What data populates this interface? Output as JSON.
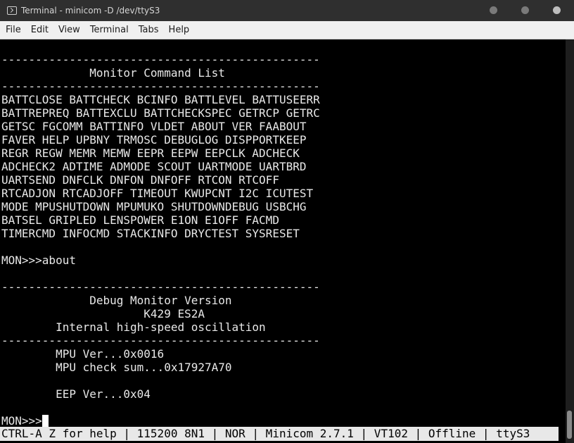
{
  "window": {
    "title": "Terminal - minicom -D /dev/ttyS3"
  },
  "menu": [
    "File",
    "Edit",
    "View",
    "Terminal",
    "Tabs",
    "Help"
  ],
  "terminal_lines": [
    "-----------------------------------------------",
    "             Monitor Command List",
    "-----------------------------------------------",
    "BATTCLOSE BATTCHECK BCINFO BATTLEVEL BATTUSEERR",
    "BATTREPREQ BATTEXCLU BATTCHECKSPEC GETRCP GETRC",
    "GETSC FGCOMM BATTINFO VLDET ABOUT VER FAABOUT",
    "FAVER HELP UPBNY TRMOSC DEBUGLOG DISPPORTKEEP",
    "REGR REGW MEMR MEMW EEPR EEPW EEPCLK ADCHECK",
    "ADCHECK2 ADTIME ADMODE SCOUT UARTMODE UARTBRD",
    "UARTSEND DNFCLK DNFON DNFOFF RTCON RTCOFF",
    "RTCADJON RTCADJOFF TIMEOUT KWUPCNT I2C ICUTEST",
    "MODE MPUSHUTDOWN MPUMUKO SHUTDOWNDEBUG USBCHG",
    "BATSEL GRIPLED LENSPOWER E1ON E1OFF FACMD",
    "TIMERCMD INFOCMD STACKINFO DRYCTEST SYSRESET",
    "",
    "MON>>>about",
    "",
    "-----------------------------------------------",
    "             Debug Monitor Version",
    "                     K429 ES2A",
    "        Internal high-speed oscillation",
    "-----------------------------------------------",
    "        MPU Ver...0x0016",
    "        MPU check sum...0x17927A70",
    "",
    "        EEP Ver...0x04",
    "",
    "MON>>>"
  ],
  "statusbar": "CTRL-A Z for help | 115200 8N1 | NOR | Minicom 2.7.1 | VT102 | Offline | ttyS3 "
}
